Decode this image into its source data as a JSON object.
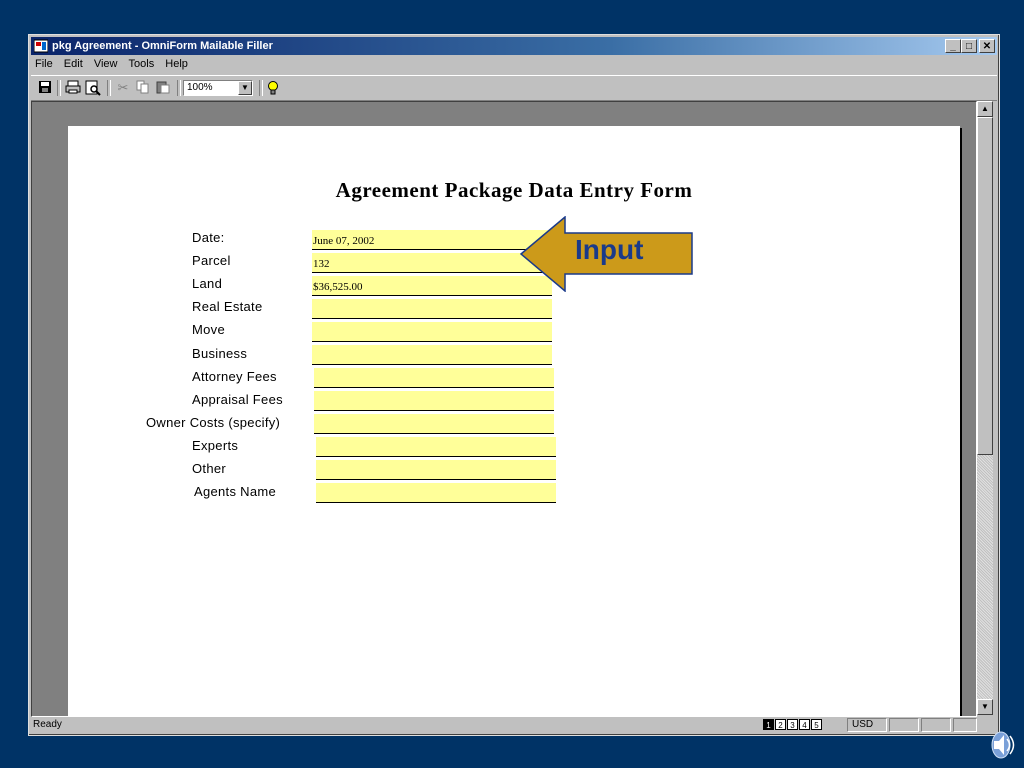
{
  "window": {
    "title": "pkg Agreement - OmniForm Mailable Filler",
    "controls": {
      "minimize": "_",
      "maximize": "□",
      "close": "✕"
    }
  },
  "menu": [
    "File",
    "Edit",
    "View",
    "Tools",
    "Help"
  ],
  "toolbar": {
    "icons": [
      "save-icon",
      "print-icon",
      "print-preview-icon",
      "cut-icon",
      "copy-icon",
      "paste-icon",
      "hint-bulb-icon"
    ],
    "zoom": "100%"
  },
  "form": {
    "title": "Agreement Package Data Entry Form",
    "fields": [
      {
        "label": "Date:",
        "value": "June 07, 2002"
      },
      {
        "label": "Parcel",
        "value": "132"
      },
      {
        "label": "Land",
        "value": "$36,525.00"
      },
      {
        "label": "Real Estate",
        "value": ""
      },
      {
        "label": "Move",
        "value": ""
      },
      {
        "label": "Business",
        "value": ""
      },
      {
        "label": "Attorney Fees",
        "value": ""
      },
      {
        "label": "Appraisal Fees",
        "value": ""
      },
      {
        "label": "Owner Costs  (specify)",
        "value": ""
      },
      {
        "label": "Experts",
        "value": ""
      },
      {
        "label": "Other",
        "value": ""
      },
      {
        "label": "Agents Name",
        "value": ""
      }
    ]
  },
  "callout": {
    "text": "Input",
    "fill_color": "#cc9a1a"
  },
  "status": {
    "text": "Ready",
    "pages": [
      "1",
      "2",
      "3",
      "4",
      "5"
    ],
    "active_page": "1",
    "currency": "USD"
  },
  "colors": {
    "background": "#003366",
    "field_fill": "#ffff99"
  }
}
